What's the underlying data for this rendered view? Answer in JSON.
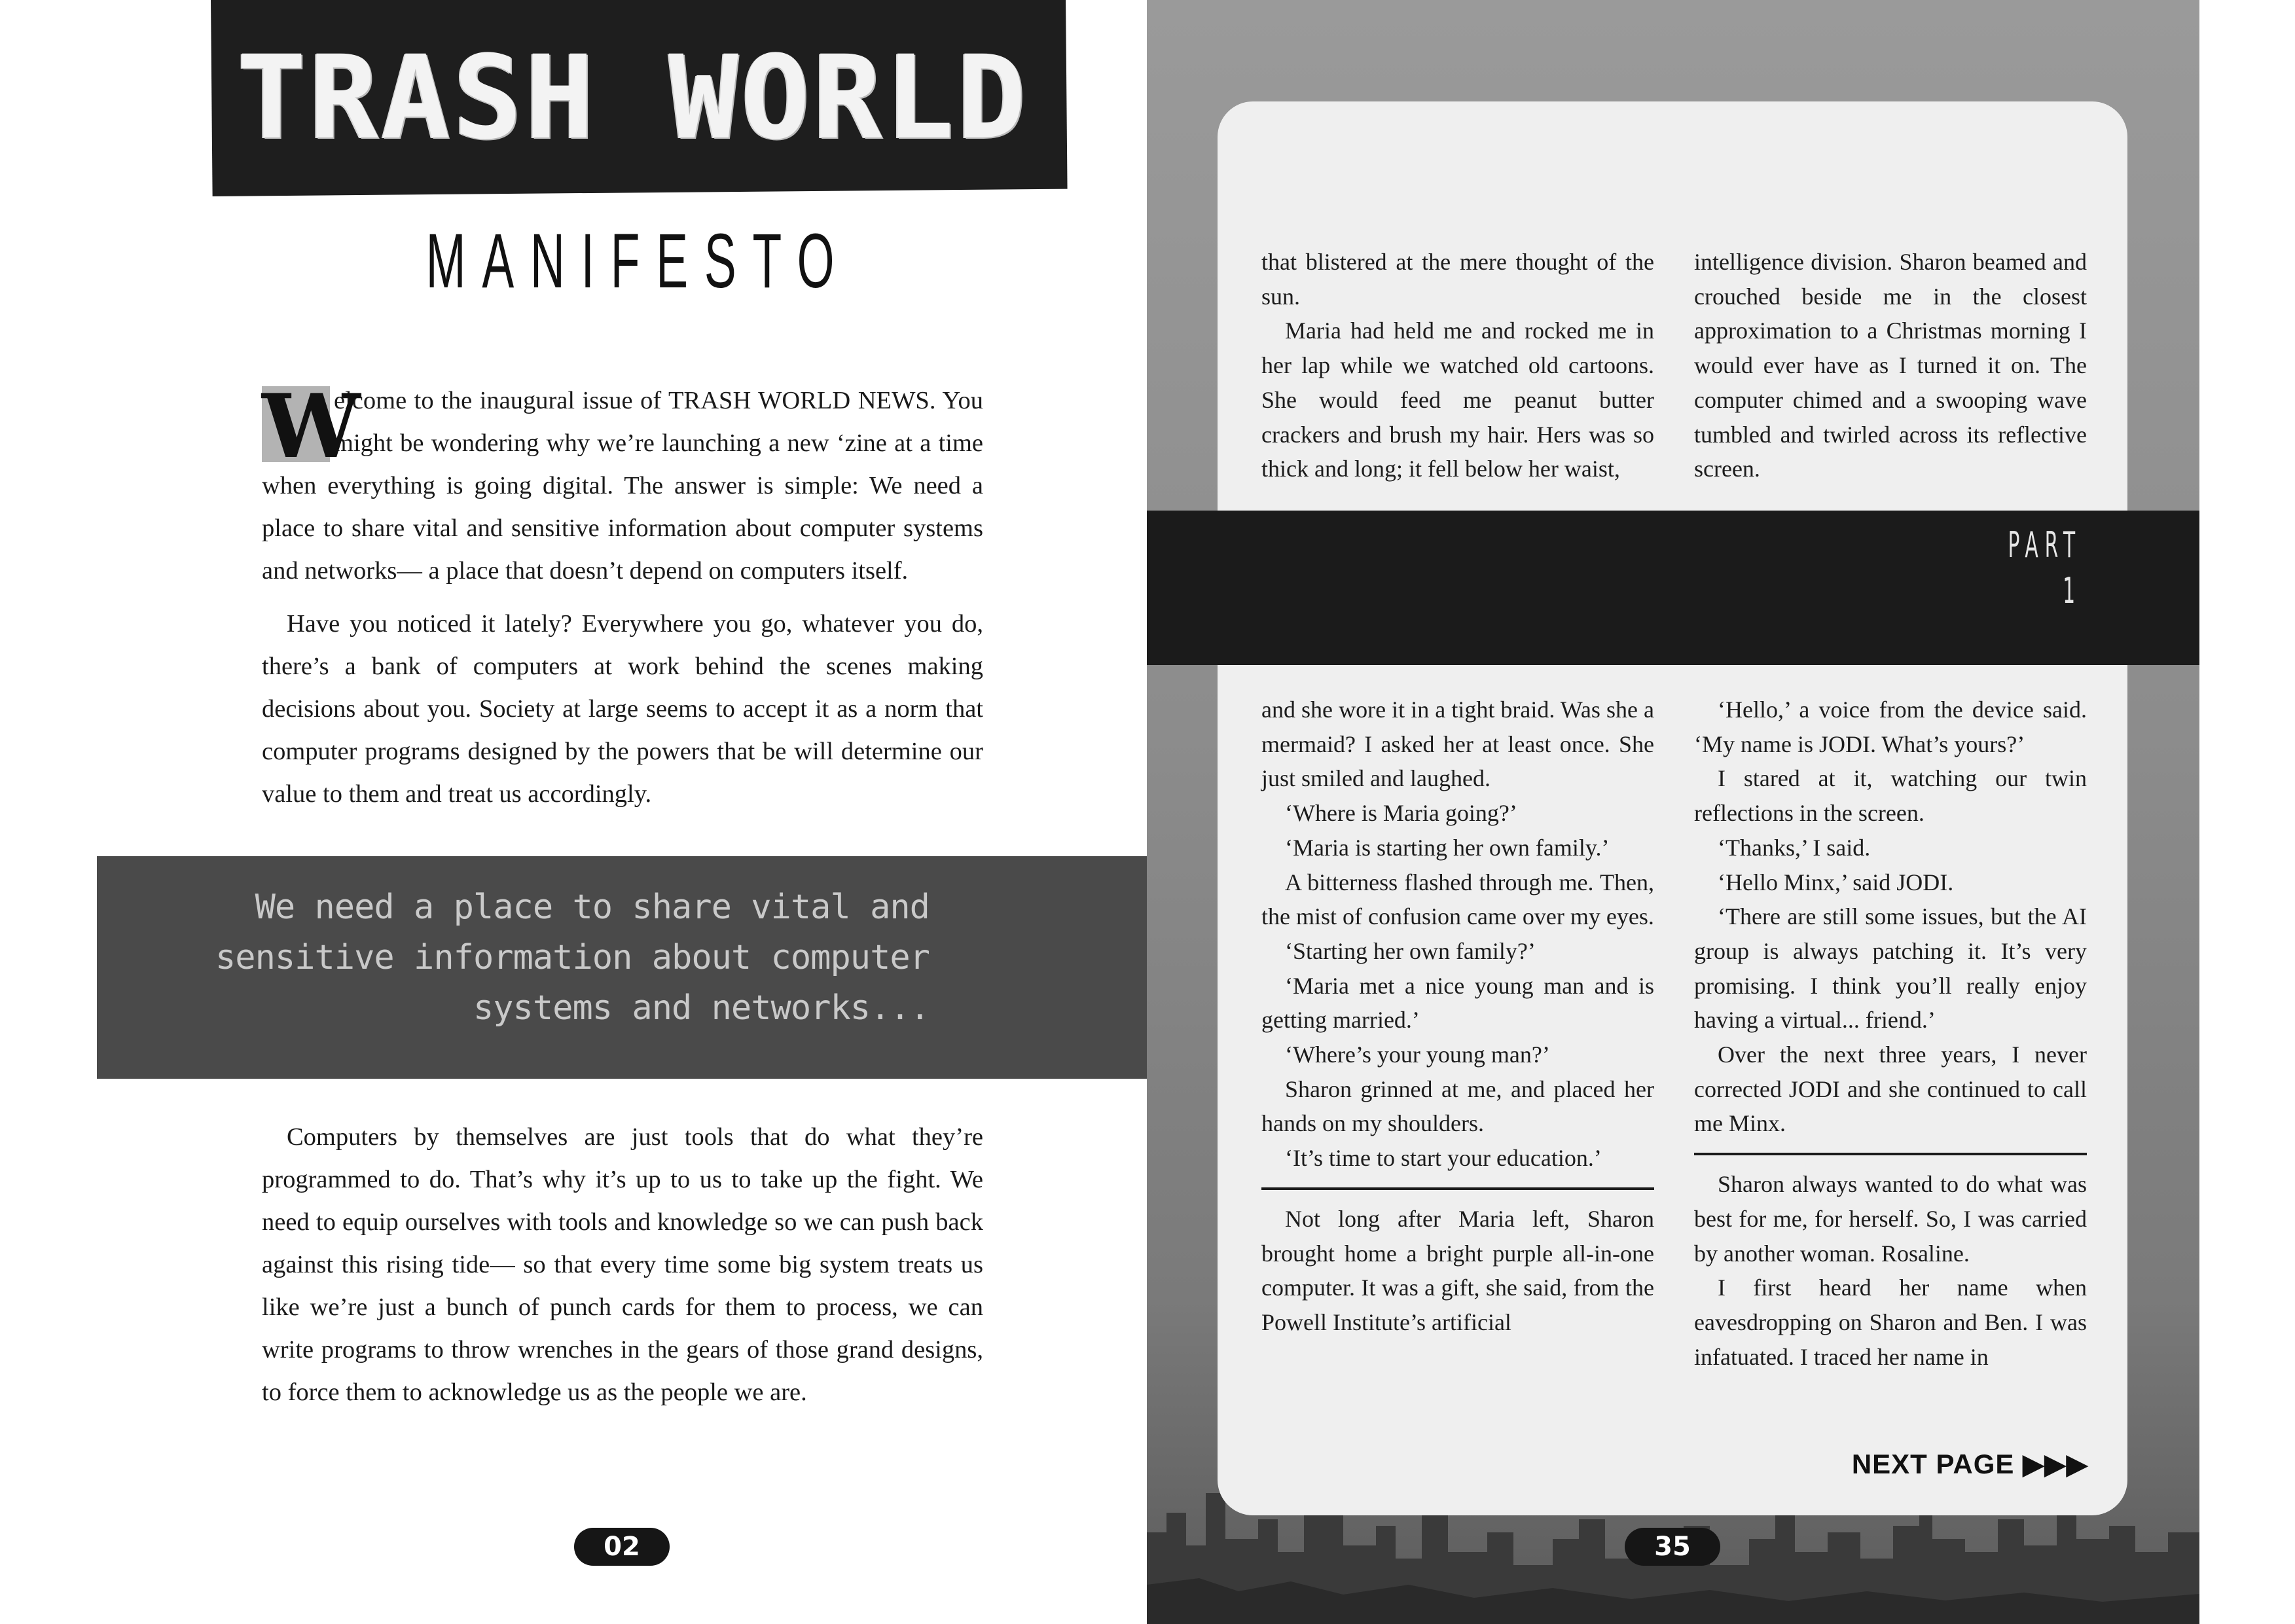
{
  "left_page": {
    "title": "TRASH WORLD",
    "subtitle": "MANIFESTO",
    "drop_cap": "W",
    "intro_paragraphs": [
      "elcome to the inaugural issue of TRASH WORLD NEWS. You might be wondering why we’re launching a new ‘zine at a time when everything is going digital. The answer is simple: We need a place to share vital and sensitive information about computer systems and networks— a place that doesn’t depend on computers itself.",
      "Have you noticed it lately? Everywhere you go, whatever you do, there’s a bank of computers at work behind the scenes making decisions about you. Society at large seems to accept it as a norm that computer programs designed by the powers that be will determine our value to them and treat us accordingly."
    ],
    "pull_quote": "We need a place to share vital and sensitive information about computer systems and networks...",
    "outro_paragraph": "Computers by themselves are just tools that do what they’re programmed to do. That’s why it’s up to us to take up the fight. We need to equip ourselves with tools and knowledge so we can push back against this rising tide— so that every time some big system treats us like we’re just a bunch of punch cards for them to process, we can write programs to throw wrenches in the gears of those grand designs, to force them to acknowledge us as the people we are.",
    "page_number": "02"
  },
  "right_page": {
    "part_label": "PART 1",
    "top_col1": [
      {
        "text": "that blistered at the mere thought of the sun.",
        "indent": false
      },
      {
        "text": "Maria had held me and rocked me in her lap while we watched old cartoons. She would feed me peanut butter crackers and brush my hair. Hers was so thick and long; it fell below her waist,",
        "indent": true
      }
    ],
    "top_col2": [
      {
        "text": "intelligence division. Sharon beamed and crouched beside me in the closest approximation to a Christmas morning I would ever have as I turned it on. The computer chimed and a swooping wave tumbled and twirled across its reflective screen.",
        "indent": false
      }
    ],
    "bottom_col1_a": [
      "and she wore it in a tight braid. Was she a mermaid? I asked her at least once. She just smiled and laughed.",
      "‘Where is Maria going?’",
      "‘Maria is starting her own family.’",
      "A bitterness flashed through me. Then, the mist of confusion came over my eyes.",
      "‘Starting her own family?’",
      "‘Maria met a nice young man and is getting married.’",
      "‘Where’s your young man?’",
      "Sharon grinned at me, and placed her hands on my shoulders.",
      "‘It’s time to start your education.’"
    ],
    "bottom_col1_b": [
      "Not long after Maria left, Sharon brought home a bright purple all-in-one computer. It was a gift, she said, from the Powell Institute’s artificial"
    ],
    "bottom_col2_a": [
      "‘Hello,’ a voice from the device said. ‘My name is JODI. What’s yours?’",
      "I stared at it, watching our twin reflections in the screen.",
      "‘Thanks,’ I said.",
      "‘Hello Minx,’ said JODI.",
      "‘There are still some issues, but the AI group is always patching it. It’s very promising. I think you’ll really enjoy having a virtual... friend.’",
      "Over the next three years, I never corrected JODI and she continued to call me Minx."
    ],
    "bottom_col2_b": [
      "Sharon always wanted to do what was best for me, for herself. So, I was carried by another woman. Rosaline.",
      "I first heard her name when eavesdropping on Sharon and Ben. I was infatuated. I traced her name in"
    ],
    "next_page_label": "NEXT PAGE ▶▶▶",
    "page_number": "35"
  }
}
